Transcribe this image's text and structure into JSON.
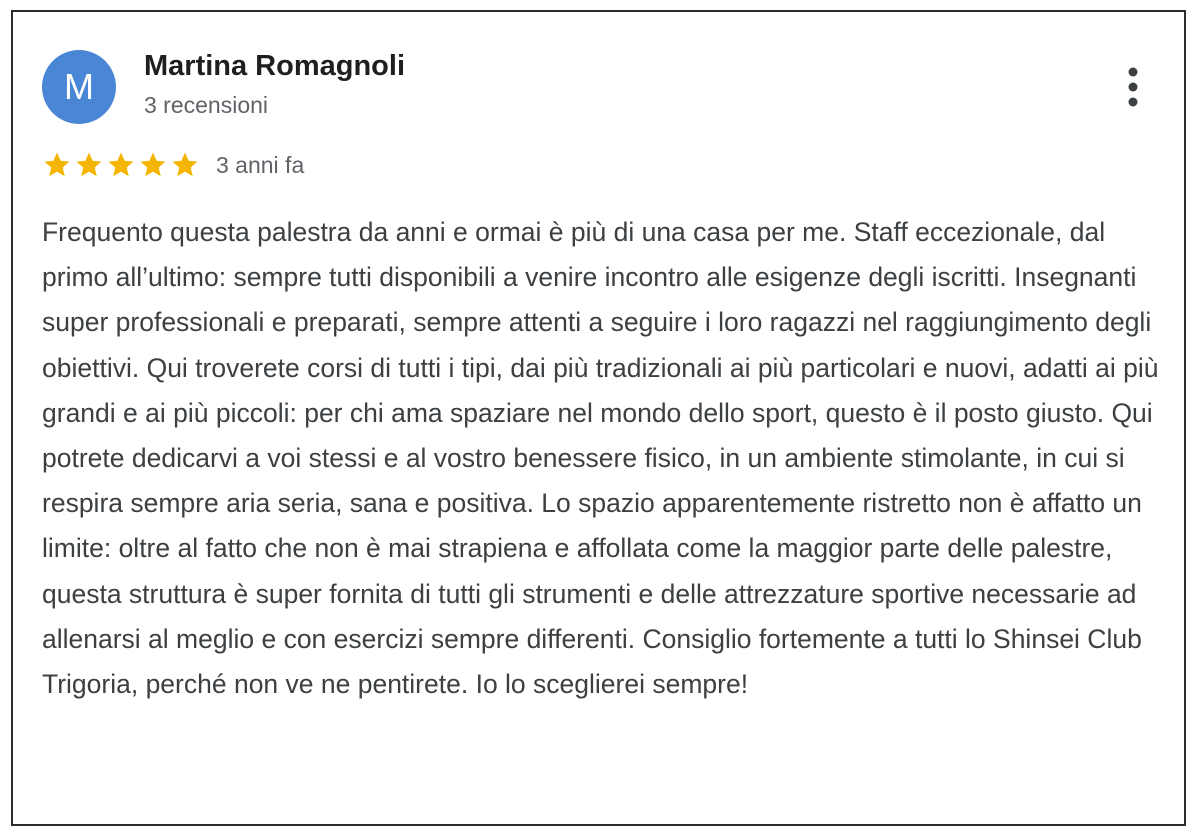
{
  "review": {
    "avatar_initial": "M",
    "author": "Martina Romagnoli",
    "review_count": "3 recensioni",
    "rating": 5,
    "rating_max": 5,
    "time_ago": "3 anni fa",
    "text": "Frequento questa palestra da anni e ormai è più di una casa per me. Staff eccezionale, dal primo all’ultimo: sempre tutti disponibili a venire incontro alle esigenze degli iscritti. Insegnanti super professionali e preparati, sempre attenti a seguire i loro ragazzi nel raggiungimento degli obiettivi. Qui troverete corsi di tutti i tipi, dai più tradizionali ai più particolari e nuovi, adatti ai più grandi e ai più piccoli: per chi ama spaziare nel mondo dello sport, questo è il posto giusto. Qui potrete dedicarvi a voi stessi e al vostro benessere fisico, in un ambiente stimolante, in cui si respira sempre aria seria, sana e positiva. Lo spazio apparentemente ristretto non è affatto un limite: oltre al fatto che non è mai strapiena e affollata come la maggior parte delle palestre, questa struttura è super fornita di tutti gli strumenti e delle attrezzature sportive necessarie ad allenarsi al meglio e con esercizi sempre differenti. Consiglio fortemente a tutti lo Shinsei Club Trigoria, perché non ve ne pentirete. Io lo sceglierei sempre!"
  },
  "icons": {
    "menu": "more-vert-icon",
    "star": "star-icon"
  },
  "colors": {
    "avatar_bg": "#4a86d6",
    "star_fill": "#f4b400",
    "author_text": "#1f1f1f",
    "meta_text": "#5f6368",
    "body_text": "#3c4043"
  }
}
